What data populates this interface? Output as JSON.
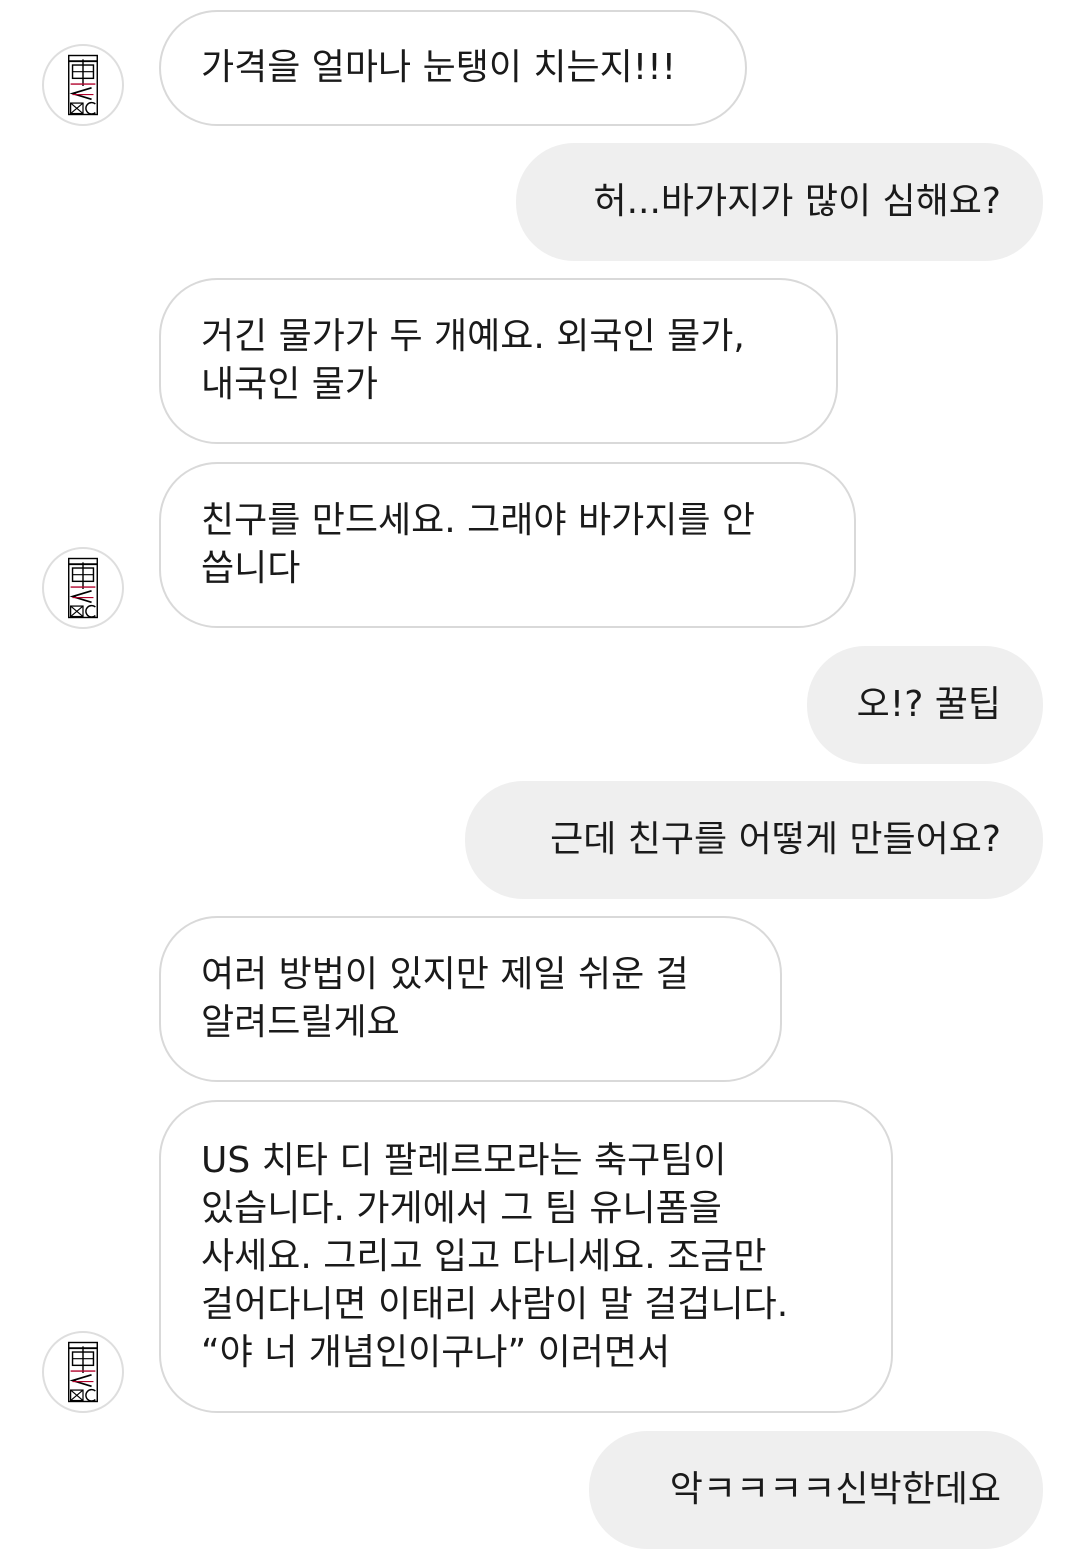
{
  "messages": [
    {
      "side": "in",
      "text": "가격을 얼마나 눈탱이 치는지!!!",
      "avatar": true
    },
    {
      "side": "out",
      "text": "허...바가지가 많이 심해요?"
    },
    {
      "side": "in",
      "text": "거긴 물가가 두 개예요. 외국인 물가,\n내국인 물가"
    },
    {
      "side": "in",
      "text": "친구를 만드세요. 그래야 바가지를 안\n씁니다",
      "avatar": true
    },
    {
      "side": "out",
      "text": "오!? 꿀팁"
    },
    {
      "side": "out",
      "text": "근데 친구를 어떻게 만들어요?"
    },
    {
      "side": "in",
      "text": "여러 방법이 있지만 제일 쉬운 걸\n알려드릴게요"
    },
    {
      "side": "in",
      "text": "US 치타 디 팔레르모라는 축구팀이\n있습니다. 가게에서 그 팀 유니폼을\n사세요. 그리고 입고 다니세요. 조금만\n걸어다니면 이태리 사람이 말 걸겁니다.\n“야 너 개념인이구나” 이러면서",
      "avatar": true
    },
    {
      "side": "out",
      "text": "악ㅋㅋㅋㅋ신박한데요"
    }
  ],
  "avatar_icon": "stamp-logo-icon",
  "colors": {
    "incoming_border": "#d9d9d9",
    "outgoing_bg": "#efefef",
    "text": "#1a1a1a"
  }
}
